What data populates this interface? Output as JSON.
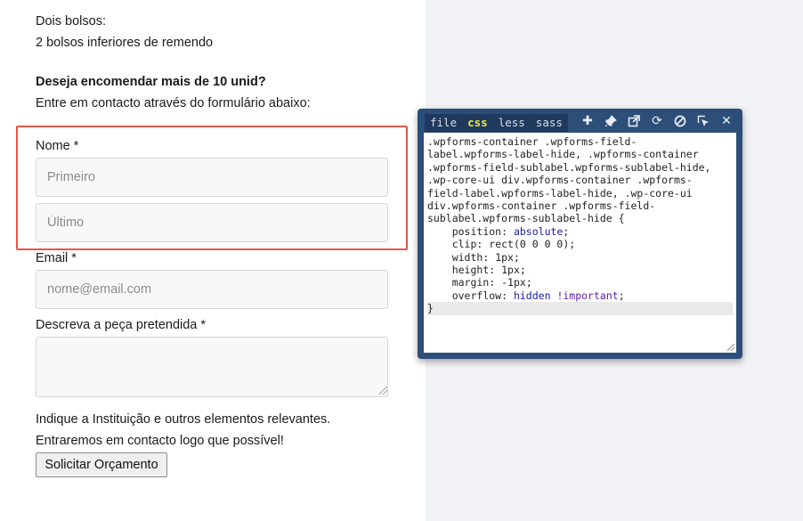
{
  "form": {
    "pockets_title": "Dois bolsos:",
    "pockets_text": "2 bolsos inferiores de remendo",
    "bulk_heading": "Deseja encomendar mais de 10 unid?",
    "bulk_text": "Entre em contacto através do formulário abaixo:",
    "name_label": "Nome *",
    "first_placeholder": "Primeiro",
    "last_placeholder": "Último",
    "email_label": "Email *",
    "email_placeholder": "nome@email.com",
    "description_label": "Descreva a peça pretendida *",
    "hint_line1": "Indique a Instituição e outros elementos relevantes.",
    "hint_line2": "Entraremos em contacto logo que possível!",
    "submit_label": "Solicitar Orçamento"
  },
  "editor": {
    "tabs": [
      "file",
      "css",
      "less",
      "sass"
    ],
    "active_tab": "css",
    "tools": [
      {
        "name": "add-icon",
        "glyph": "✚"
      },
      {
        "name": "pin-icon",
        "glyph": "📌"
      },
      {
        "name": "popout-icon",
        "glyph": "⧉"
      },
      {
        "name": "refresh-icon",
        "glyph": "⟳"
      },
      {
        "name": "disable-icon",
        "glyph": "⊘"
      },
      {
        "name": "inspect-icon",
        "glyph": "⬚"
      },
      {
        "name": "close-icon",
        "glyph": "✕"
      }
    ],
    "code_selector": ".wpforms-container .wpforms-field-\nlabel.wpforms-label-hide, .wpforms-container\n.wpforms-field-sublabel.wpforms-sublabel-hide,\n.wp-core-ui div.wpforms-container .wpforms-\nfield-label.wpforms-label-hide, .wp-core-ui\ndiv.wpforms-container .wpforms-field-\nsublabel.wpforms-sublabel-hide {",
    "declarations": [
      {
        "prop": "position",
        "value": "absolute"
      },
      {
        "prop": "clip",
        "value": "rect(0 0 0 0)"
      },
      {
        "prop": "width",
        "value": "1px"
      },
      {
        "prop": "height",
        "value": "1px"
      },
      {
        "prop": "margin",
        "value": "-1px"
      },
      {
        "prop": "overflow",
        "value": "hidden",
        "important": "!important"
      }
    ],
    "closing": "}"
  }
}
